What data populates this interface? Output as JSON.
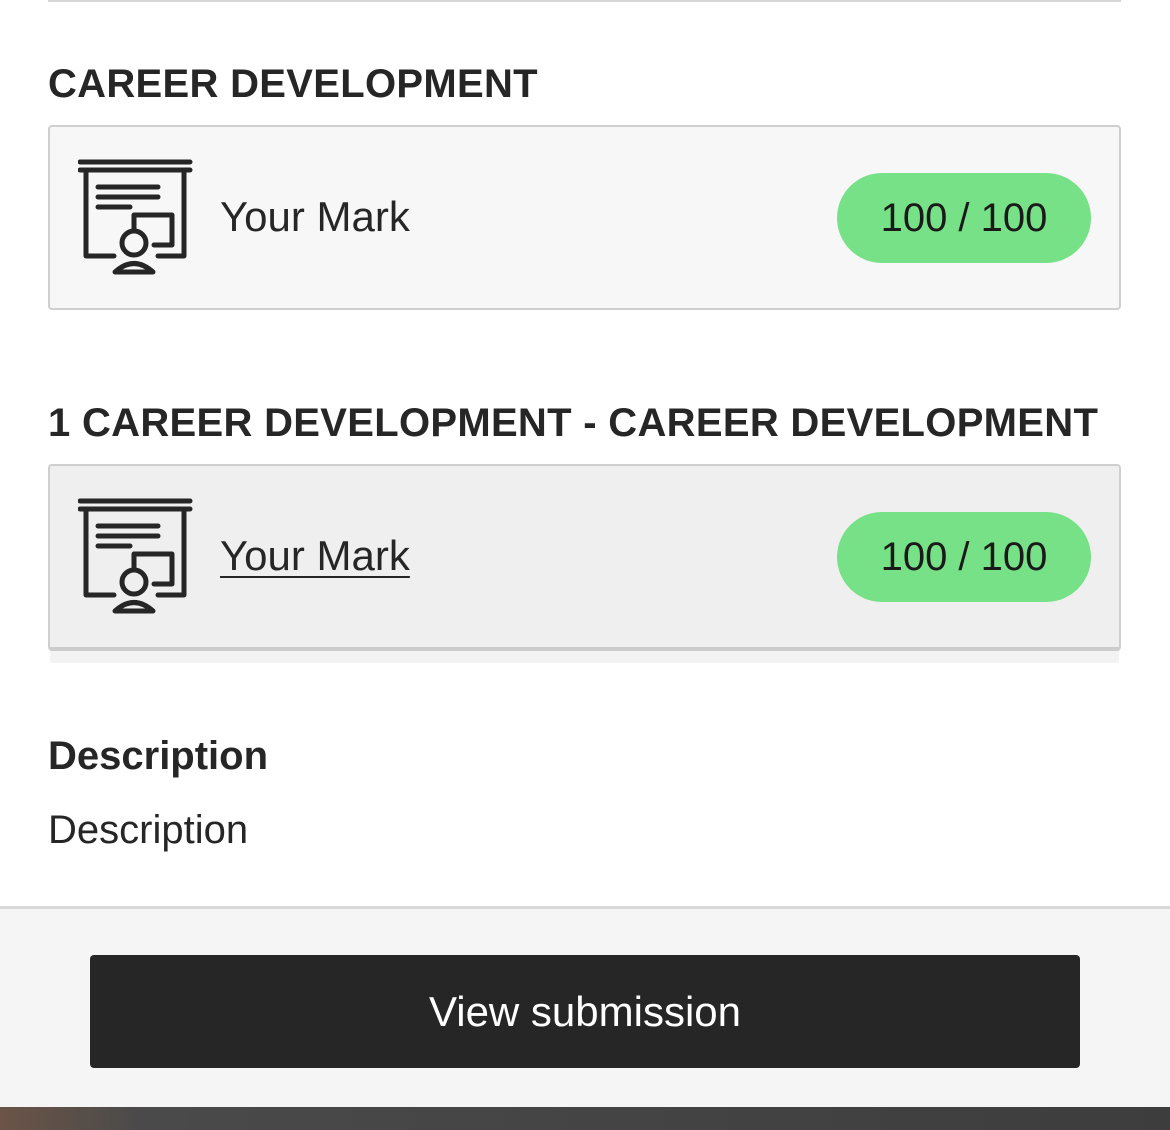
{
  "sections": [
    {
      "heading": "CAREER DEVELOPMENT",
      "mark": {
        "icon": "presentation-board-icon",
        "label": "Your Mark",
        "score": "100 / 100",
        "score_color": "#76e187",
        "is_link": false
      }
    },
    {
      "heading": "1 CAREER DEVELOPMENT - CAREER DEVELOPMENT",
      "mark": {
        "icon": "presentation-board-icon",
        "label": "Your Mark",
        "score": "100 / 100",
        "score_color": "#76e187",
        "is_link": true
      }
    }
  ],
  "description": {
    "heading": "Description",
    "text": "Description"
  },
  "footer": {
    "button_label": "View submission",
    "button_color": "#262626"
  }
}
